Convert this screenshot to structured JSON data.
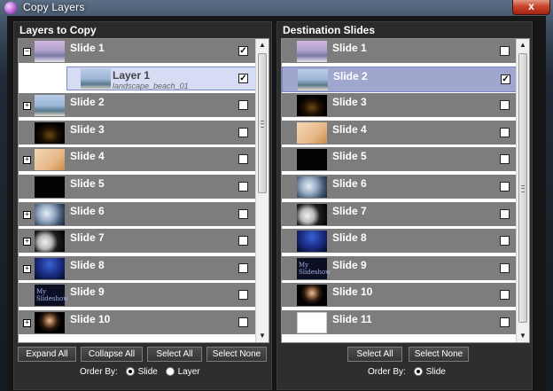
{
  "window": {
    "title": "Copy Layers",
    "close_label": "x"
  },
  "left_pane": {
    "header": "Layers to Copy",
    "rows": [
      {
        "label": "Slide 1",
        "expander": "−",
        "thumb": "t-beach",
        "checked": true
      },
      {
        "label": "Layer 1",
        "sublabel": "landscape_beach_01",
        "layer": true,
        "thumb": "t-beach2",
        "checked": true
      },
      {
        "label": "Slide 2",
        "expander": "+",
        "thumb": "t-beach2",
        "checked": false
      },
      {
        "label": "Slide 3",
        "expander": "",
        "thumb": "t-dark-title",
        "checked": false
      },
      {
        "label": "Slide 4",
        "expander": "+",
        "thumb": "t-paper",
        "checked": false
      },
      {
        "label": "Slide 5",
        "expander": "",
        "thumb": "t-black",
        "checked": false
      },
      {
        "label": "Slide 6",
        "expander": "+",
        "thumb": "t-clouds",
        "checked": false
      },
      {
        "label": "Slide 7",
        "expander": "+",
        "thumb": "t-moon",
        "checked": false
      },
      {
        "label": "Slide 8",
        "expander": "+",
        "thumb": "t-blue",
        "checked": false
      },
      {
        "label": "Slide 9",
        "expander": "",
        "thumb": "t-text",
        "thumb_text": "My Slideshow",
        "checked": false
      },
      {
        "label": "Slide 10",
        "expander": "+",
        "thumb": "t-person",
        "checked": false
      }
    ],
    "buttons": {
      "expand_all": "Expand All",
      "collapse_all": "Collapse All",
      "select_all": "Select All",
      "select_none": "Select None"
    },
    "order_by": {
      "label": "Order By:",
      "opt1": "Slide",
      "opt2": "Layer"
    }
  },
  "right_pane": {
    "header": "Destination Slides",
    "rows": [
      {
        "label": "Slide 1",
        "thumb": "t-beach",
        "checked": false
      },
      {
        "label": "Slide 2",
        "thumb": "t-beach2",
        "checked": true,
        "selected": true
      },
      {
        "label": "Slide 3",
        "thumb": "t-dark-title",
        "checked": false
      },
      {
        "label": "Slide 4",
        "thumb": "t-paper",
        "checked": false
      },
      {
        "label": "Slide 5",
        "thumb": "t-black",
        "checked": false
      },
      {
        "label": "Slide 6",
        "thumb": "t-clouds",
        "checked": false
      },
      {
        "label": "Slide 7",
        "thumb": "t-moon",
        "checked": false
      },
      {
        "label": "Slide 8",
        "thumb": "t-blue",
        "checked": false
      },
      {
        "label": "Slide 9",
        "thumb": "t-text",
        "thumb_text": "My Slideshow",
        "checked": false
      },
      {
        "label": "Slide 10",
        "thumb": "t-person",
        "checked": false
      },
      {
        "label": "Slide 11",
        "thumb": "t-white",
        "checked": false
      }
    ],
    "buttons": {
      "select_all": "Select All",
      "select_none": "Select None"
    },
    "order_by": {
      "label": "Order By:",
      "opt1": "Slide"
    }
  },
  "colors": {
    "row_bg": "#7d7d7d",
    "selected_row": "#9fa7cf",
    "accent_border": "#7b89c7"
  },
  "icons": {
    "check": "✓",
    "scroll_up": "▲",
    "scroll_down": "▼"
  }
}
